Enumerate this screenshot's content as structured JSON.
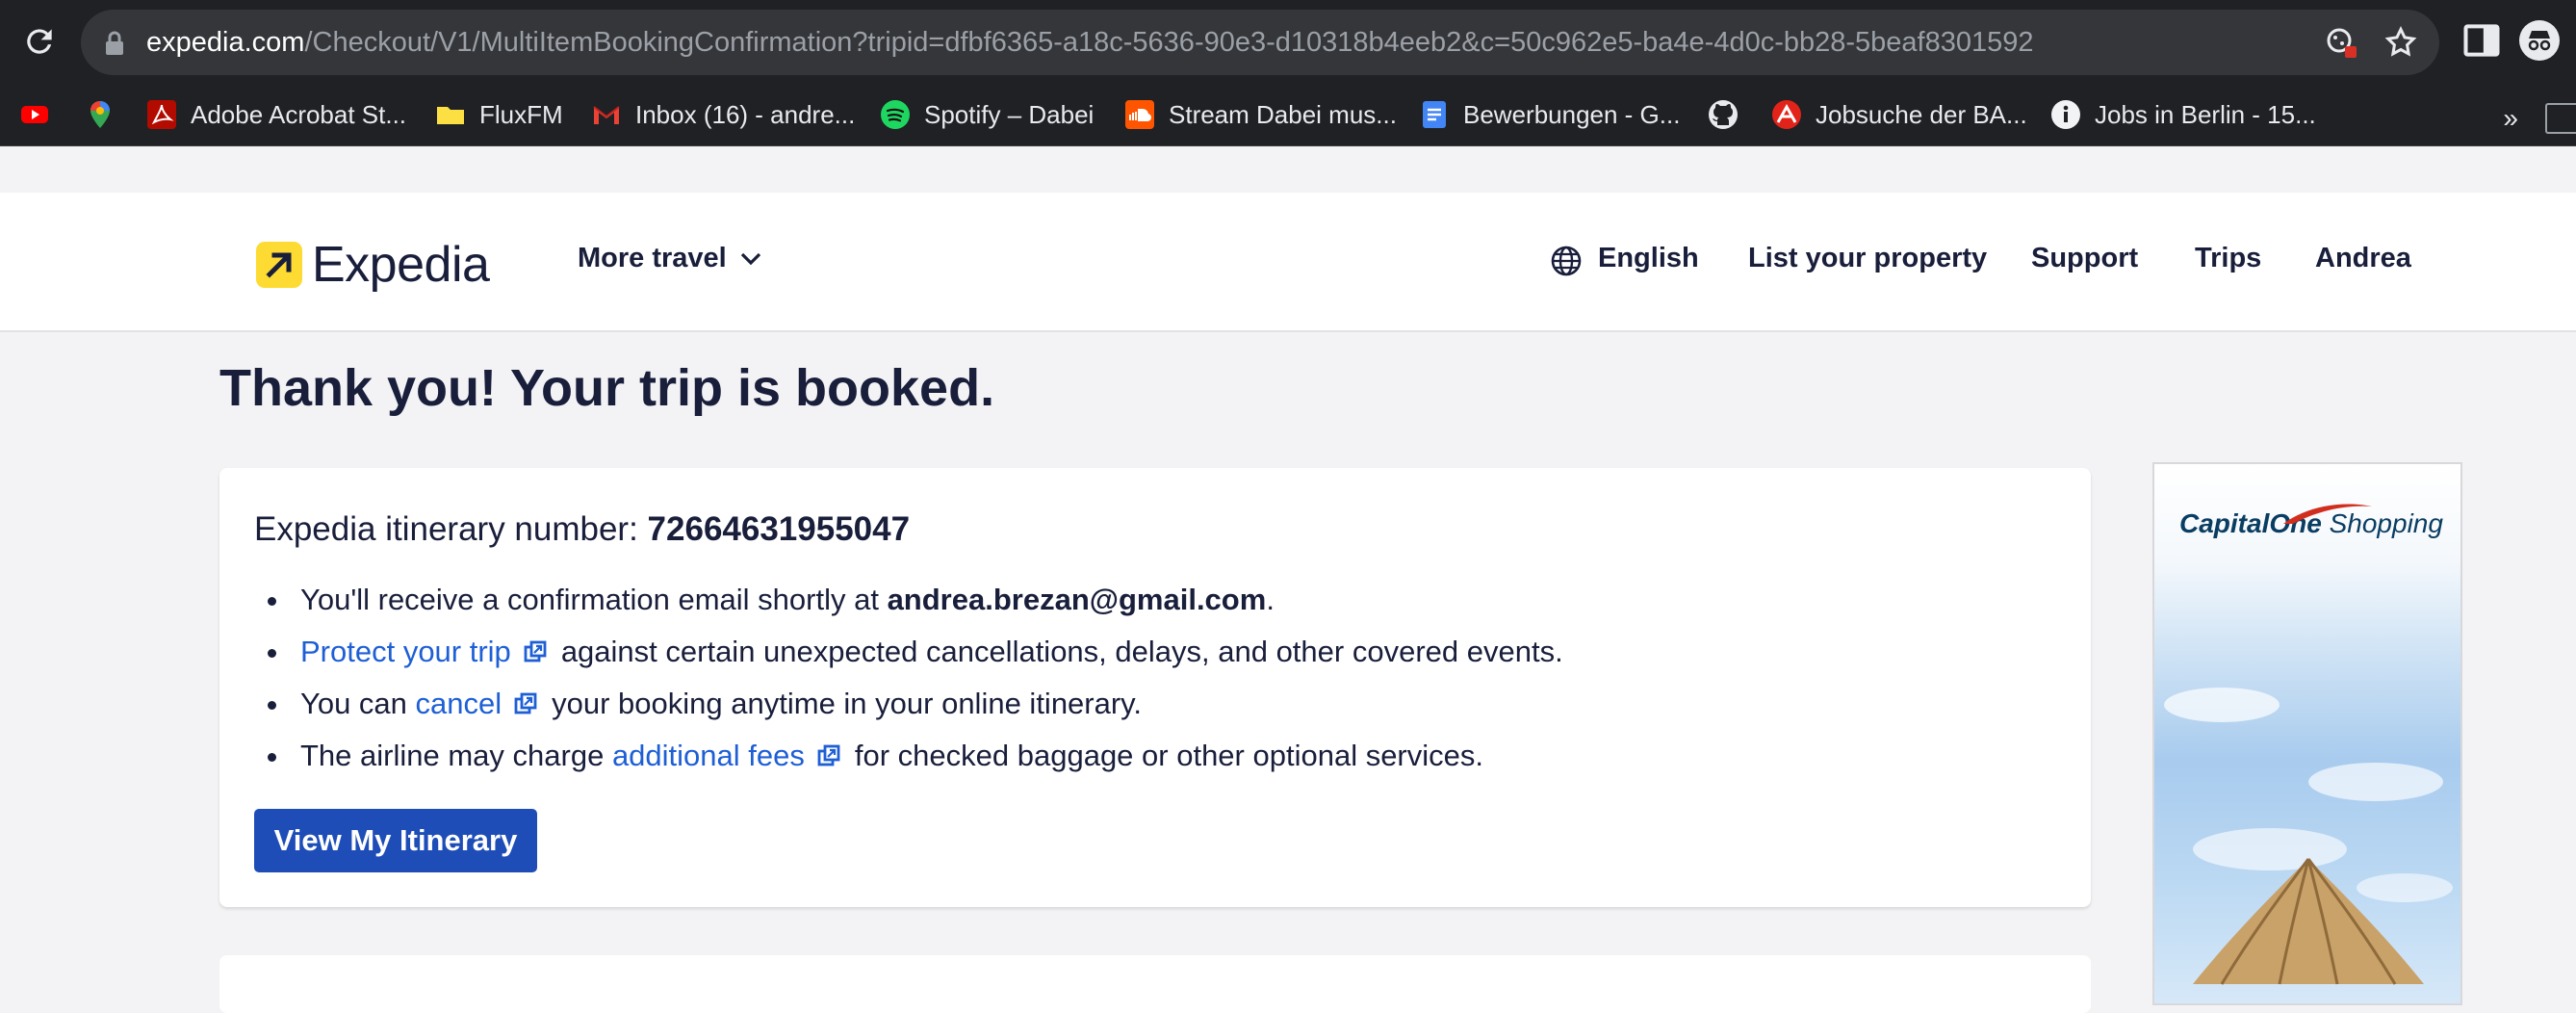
{
  "browser": {
    "url_host": "expedia.com",
    "url_path": "/Checkout/V1/MultiItemBookingConfirmation?tripid=dfbf6365-a18c-5636-90e3-d10318b4eeb2&c=50c962e5-ba4e-4d0c-bb28-5beaf8301592",
    "bookmarks": [
      {
        "label": "",
        "icon": "youtube-icon"
      },
      {
        "label": "",
        "icon": "maps-pin-icon"
      },
      {
        "label": "Adobe Acrobat St...",
        "icon": "adobe-acrobat-icon"
      },
      {
        "label": "FluxFM",
        "icon": "folder-icon"
      },
      {
        "label": "Inbox (16) - andre...",
        "icon": "gmail-icon"
      },
      {
        "label": "Spotify – Dabei",
        "icon": "spotify-icon"
      },
      {
        "label": "Stream Dabei mus...",
        "icon": "soundcloud-icon"
      },
      {
        "label": "Bewerbungen - G...",
        "icon": "google-docs-icon"
      },
      {
        "label": "",
        "icon": "github-icon"
      },
      {
        "label": "Jobsuche der BA...",
        "icon": "jobsuche-icon"
      },
      {
        "label": "Jobs in Berlin - 15...",
        "icon": "info-icon"
      }
    ],
    "more_label": "»"
  },
  "header": {
    "logo_text": "Expedia",
    "more_travel": "More travel",
    "language": "English",
    "list_property": "List your property",
    "support": "Support",
    "trips": "Trips",
    "user": "Andrea"
  },
  "main": {
    "title": "Thank you! Your trip is booked.",
    "itinerary_label": "Expedia itinerary number: ",
    "itinerary_number": "72664631955047",
    "email_prefix": "You'll receive a confirmation email shortly at ",
    "email": "andrea.brezan@gmail.com",
    "email_suffix": ".",
    "protect_link": "Protect your trip",
    "protect_suffix": "against certain unexpected cancellations, delays, and other covered events.",
    "cancel_prefix": "You can ",
    "cancel_link": "cancel",
    "cancel_suffix": "your booking anytime in your online itinerary.",
    "fees_prefix": "The airline may charge ",
    "fees_link": "additional fees",
    "fees_suffix": "for checked baggage or other optional services.",
    "button_label": "View My Itinerary"
  },
  "ad": {
    "brand_a": "Capital",
    "brand_b": "One",
    "brand_c": " Shopping"
  },
  "colors": {
    "link": "#1e5fd6",
    "button": "#1e4db7",
    "logo_yellow": "#fddb32",
    "navy": "#191e3b"
  }
}
